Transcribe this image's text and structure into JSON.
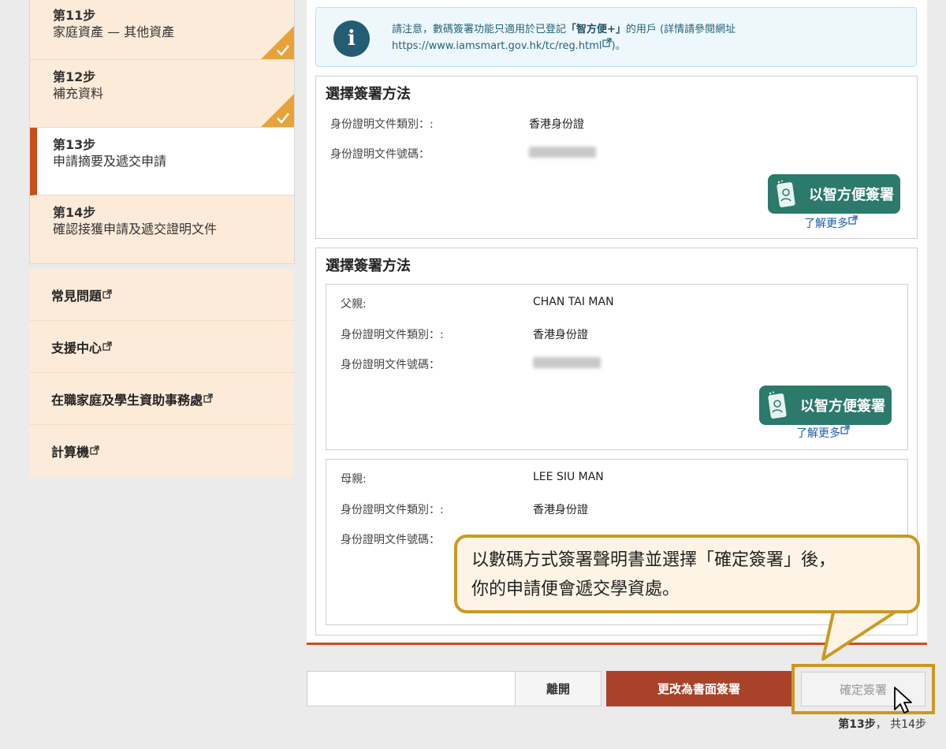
{
  "sidebar": {
    "steps": [
      {
        "num": "第11步",
        "title": "家庭資產 — 其他資產"
      },
      {
        "num": "第12步",
        "title": "補充資料"
      },
      {
        "num": "第13步",
        "title": "申請摘要及遞交申請"
      },
      {
        "num": "第14步",
        "title": "確認接獲申請及遞交證明文件"
      }
    ],
    "links": [
      "常見問題",
      "支援中心",
      "在職家庭及學生資助事務處",
      "計算機"
    ]
  },
  "notice": {
    "line1_prefix": "請注意，數碼簽署功能只適用於已登記",
    "line1_bold": "「智方便+」",
    "line1_suffix": "的用戶 (詳情請參閱網址",
    "url": "https://www.iamsmart.gov.hk/tc/reg.html",
    "line2_suffix": ")。"
  },
  "card1": {
    "title": "選擇簽署方法",
    "doc_type_label": "身份證明文件類別：:",
    "doc_type_value": "香港身份證",
    "doc_no_label": "身份證明文件號碼："
  },
  "card2": {
    "title": "選擇簽署方法",
    "father": {
      "relation_label": "父親:",
      "name": "CHAN TAI MAN",
      "doc_type_label": "身份證明文件類別：:",
      "doc_type_value": "香港身份證",
      "doc_no_label": "身份證明文件號碼："
    },
    "mother": {
      "relation_label": "母親:",
      "name": "LEE SIU MAN",
      "doc_type_label": "身份證明文件類別：:",
      "doc_type_value": "香港身份證",
      "doc_no_label": "身份證明文件號碼："
    }
  },
  "iamsmart": {
    "button_label": "以智方便簽署",
    "learn_more": "了解更多"
  },
  "buttons": {
    "leave": "離開",
    "paper": "更改為書面簽署",
    "confirm": "確定簽署"
  },
  "pager": {
    "current": "第13步",
    "sep": "，",
    "total": "共14步"
  },
  "callout": {
    "line1": "以數碼方式簽署聲明書並選擇「確定簽署」後，",
    "line2": "你的申請便會遞交學資處。"
  },
  "colors": {
    "accent": "#c8511b",
    "iamsmart": "#2b7a6c",
    "highlight": "#c99a22",
    "step_bg": "#fdebd9"
  }
}
